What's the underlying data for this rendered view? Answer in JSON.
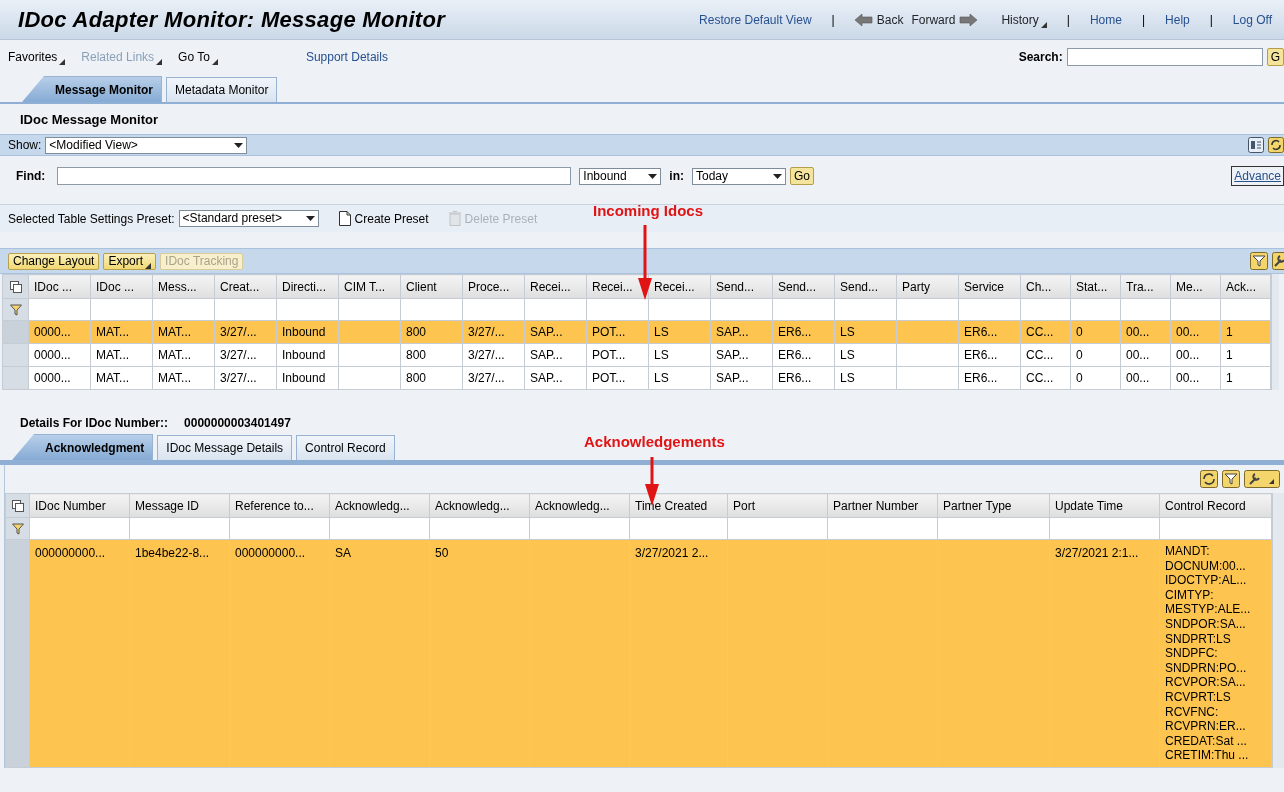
{
  "header": {
    "title": "IDoc Adapter Monitor: Message Monitor",
    "links": [
      {
        "label": "Restore Default View",
        "kind": "link"
      },
      {
        "label": "|",
        "kind": "separator"
      },
      {
        "label": "Back",
        "kind": "back"
      },
      {
        "label": "Forward",
        "kind": "forward"
      },
      {
        "label": "History",
        "kind": "menu"
      },
      {
        "label": "|",
        "kind": "separator"
      },
      {
        "label": "Home",
        "kind": "link"
      },
      {
        "label": "|",
        "kind": "separator"
      },
      {
        "label": "Help",
        "kind": "link"
      },
      {
        "label": "|",
        "kind": "separator"
      },
      {
        "label": "Log Off",
        "kind": "link"
      }
    ]
  },
  "menu": [
    {
      "label": "Favorites",
      "disabled": false
    },
    {
      "label": "Related Links",
      "disabled": true
    },
    {
      "label": "Go To",
      "disabled": false
    }
  ],
  "support_link": "Support Details",
  "search": {
    "label": "Search:",
    "button": "G"
  },
  "tabs": [
    {
      "label": "Message Monitor",
      "selected": true
    },
    {
      "label": "Metadata Monitor",
      "selected": false
    }
  ],
  "section_title": "IDoc Message Monitor",
  "show": {
    "label": "Show:",
    "value": "<Modified View>"
  },
  "find": {
    "label": "Find:",
    "direction": "Inbound",
    "in_label": "in:",
    "period": "Today",
    "go": "Go",
    "advanced": "Advance"
  },
  "preset": {
    "label": "Selected Table Settings Preset:",
    "value": "<Standard preset>",
    "actions": [
      {
        "label": "Create Preset",
        "disabled": false
      },
      {
        "label": "Delete Preset",
        "disabled": true
      }
    ]
  },
  "annotations": [
    {
      "text": "Incoming Idocs"
    },
    {
      "text": "Acknowledgements"
    }
  ],
  "table": {
    "toolbar": [
      {
        "label": "Change Layout",
        "disabled": false,
        "menu": false
      },
      {
        "label": "Export",
        "disabled": false,
        "menu": true
      },
      {
        "label": "IDoc Tracking",
        "disabled": true,
        "menu": false
      }
    ],
    "columns": [
      "IDoc ...",
      "IDoc ...",
      "Mess...",
      "Creat...",
      "Directi...",
      "CIM T...",
      "Client",
      "Proce...",
      "Recei...",
      "Recei...",
      "Recei...",
      "Send...",
      "Send...",
      "Send...",
      "Party",
      "Service",
      "Ch...",
      "Stat...",
      "Tra...",
      "Me...",
      "Ack..."
    ],
    "rows": [
      {
        "selected": true,
        "cells": [
          "0000...",
          "MAT...",
          "MAT...",
          "3/27/...",
          "Inbound",
          "",
          "800",
          "3/27/...",
          "SAP...",
          "POT...",
          "LS",
          "SAP...",
          "ER6...",
          "LS",
          "",
          "ER6...",
          "CC...",
          "0",
          "00...",
          "00...",
          "1"
        ]
      },
      {
        "selected": false,
        "cells": [
          "0000...",
          "MAT...",
          "MAT...",
          "3/27/...",
          "Inbound",
          "",
          "800",
          "3/27/...",
          "SAP...",
          "POT...",
          "LS",
          "SAP...",
          "ER6...",
          "LS",
          "",
          "ER6...",
          "CC...",
          "0",
          "00...",
          "00...",
          "1"
        ]
      },
      {
        "selected": false,
        "cells": [
          "0000...",
          "MAT...",
          "MAT...",
          "3/27/...",
          "Inbound",
          "",
          "800",
          "3/27/...",
          "SAP...",
          "POT...",
          "LS",
          "SAP...",
          "ER6...",
          "LS",
          "",
          "ER6...",
          "CC...",
          "0",
          "00...",
          "00...",
          "1"
        ]
      }
    ]
  },
  "details": {
    "label": "Details For IDoc Number::",
    "value": "0000000003401497"
  },
  "detail_tabs": [
    {
      "label": "Acknowledgment",
      "selected": true
    },
    {
      "label": "IDoc Message Details",
      "selected": false
    },
    {
      "label": "Control Record",
      "selected": false
    }
  ],
  "ack_table": {
    "columns": [
      "IDoc Number",
      "Message ID",
      "Reference to...",
      "Acknowledg...",
      "Acknowledg...",
      "Acknowledg...",
      "Time Created",
      "Port",
      "Partner Number",
      "Partner Type",
      "Update Time",
      "Control Record"
    ],
    "rows": [
      {
        "selected": true,
        "cells": [
          "000000000...",
          "1be4be22-8...",
          "000000000...",
          "SA",
          "50",
          "",
          "3/27/2021 2...",
          "",
          "",
          "",
          "3/27/2021 2:1..."
        ],
        "control_record": [
          "MANDT:",
          "DOCNUM:00...",
          "IDOCTYP:AL...",
          "CIMTYP:",
          "MESTYP:ALE...",
          "SNDPOR:SA...",
          "SNDPRT:LS",
          "SNDPFC:",
          "SNDPRN:PO...",
          "RCVPOR:SA...",
          "RCVPRT:LS",
          "RCVFNC:",
          "RCVPRN:ER...",
          "CREDAT:Sat ...",
          "CRETIM:Thu ..."
        ]
      }
    ]
  }
}
